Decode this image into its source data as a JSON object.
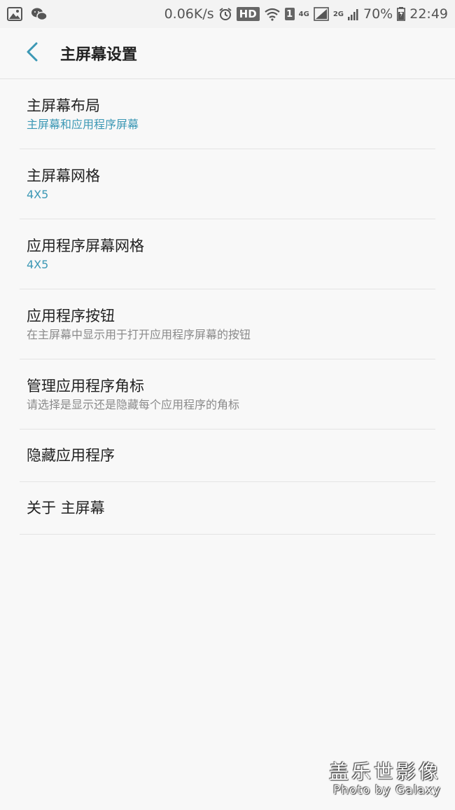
{
  "status_bar": {
    "left_icons": [
      "gallery-icon",
      "wechat-icon"
    ],
    "speed": "0.06K/s",
    "hd": "HD",
    "sim": "1",
    "net_4g": "4G",
    "net_2g": "2G",
    "battery": "70%",
    "time": "22:49"
  },
  "header": {
    "back_icon": "chevron-left-icon",
    "title": "主屏幕设置"
  },
  "items": [
    {
      "title": "主屏幕布局",
      "subtitle": "主屏幕和应用程序屏幕"
    },
    {
      "title": "主屏幕网格",
      "subtitle": "4X5"
    },
    {
      "title": "应用程序屏幕网格",
      "subtitle": "4X5"
    },
    {
      "title": "应用程序按钮",
      "subtitle": "在主屏幕中显示用于打开应用程序屏幕的按钮"
    },
    {
      "title": "管理应用程序角标",
      "subtitle": "请选择是显示还是隐藏每个应用程序的角标"
    },
    {
      "title": "隐藏应用程序"
    },
    {
      "title": "关于 主屏幕"
    }
  ],
  "colors": {
    "accent": "#3c98b5",
    "muted": "#8a8a8a",
    "background": "#f8f8f8"
  },
  "watermark": {
    "main": "盖乐世影像",
    "sub": "Photo by Galaxy"
  }
}
